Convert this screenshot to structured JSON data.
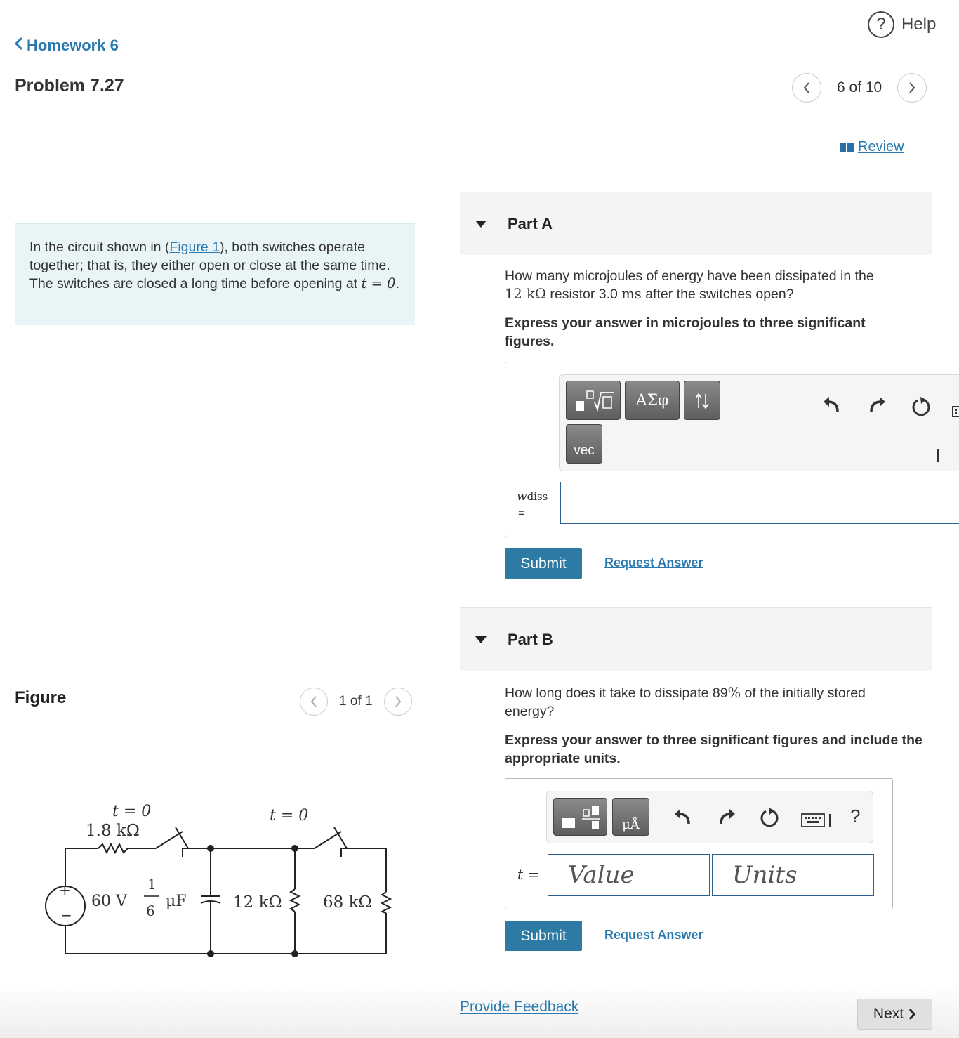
{
  "header": {
    "help_label": "Help",
    "back_label": "Homework 6",
    "problem_title": "Problem 7.27",
    "pager_text": "6 of 10"
  },
  "intro": {
    "text_before_link": "In the circuit shown in (",
    "figure_link": "Figure 1",
    "text_after_link": "), both switches operate together; that is, they either open or close at the same time. The switches are closed a long time before opening at ",
    "math": "t = 0",
    "end": "."
  },
  "figure": {
    "title": "Figure",
    "pager_text": "1 of 1",
    "labels": {
      "switch1_time": "t = 0",
      "r1": "1.8 kΩ",
      "switch2_time": "t = 0",
      "source": "60 V",
      "cap_num": "1",
      "cap_den": "6",
      "cap_unit": "μF",
      "r2": "12 kΩ",
      "r3": "68 kΩ",
      "plus": "+",
      "minus": "−"
    }
  },
  "review_label": "Review",
  "partA": {
    "label": "Part A",
    "q_line1": "How many microjoules of energy have been dissipated in the",
    "q_line2_val": "12 kΩ",
    "q_line2_mid": " resistor 3.0 ",
    "q_line2_unit": "ms",
    "q_line2_end": " after the switches open?",
    "instruction": "Express your answer in microjoules to three significant figures.",
    "toolbar": {
      "greek": "ΑΣφ",
      "vec": "vec"
    },
    "var_label": "w",
    "var_sub": "diss",
    "equals": "=",
    "submit": "Submit",
    "request": "Request Answer"
  },
  "partB": {
    "label": "Part B",
    "q_before": "How long does it take to dissipate 89",
    "q_pct": "%",
    "q_after": " of the initially stored energy?",
    "instruction": "Express your answer to three significant figures and include the appropriate units.",
    "toolbar": {
      "units": "μÅ",
      "help": "?"
    },
    "var_label": "t =",
    "value_placeholder": "Value",
    "units_placeholder": "Units",
    "submit": "Submit",
    "request": "Request Answer"
  },
  "footer": {
    "feedback": "Provide Feedback",
    "next": "Next"
  }
}
